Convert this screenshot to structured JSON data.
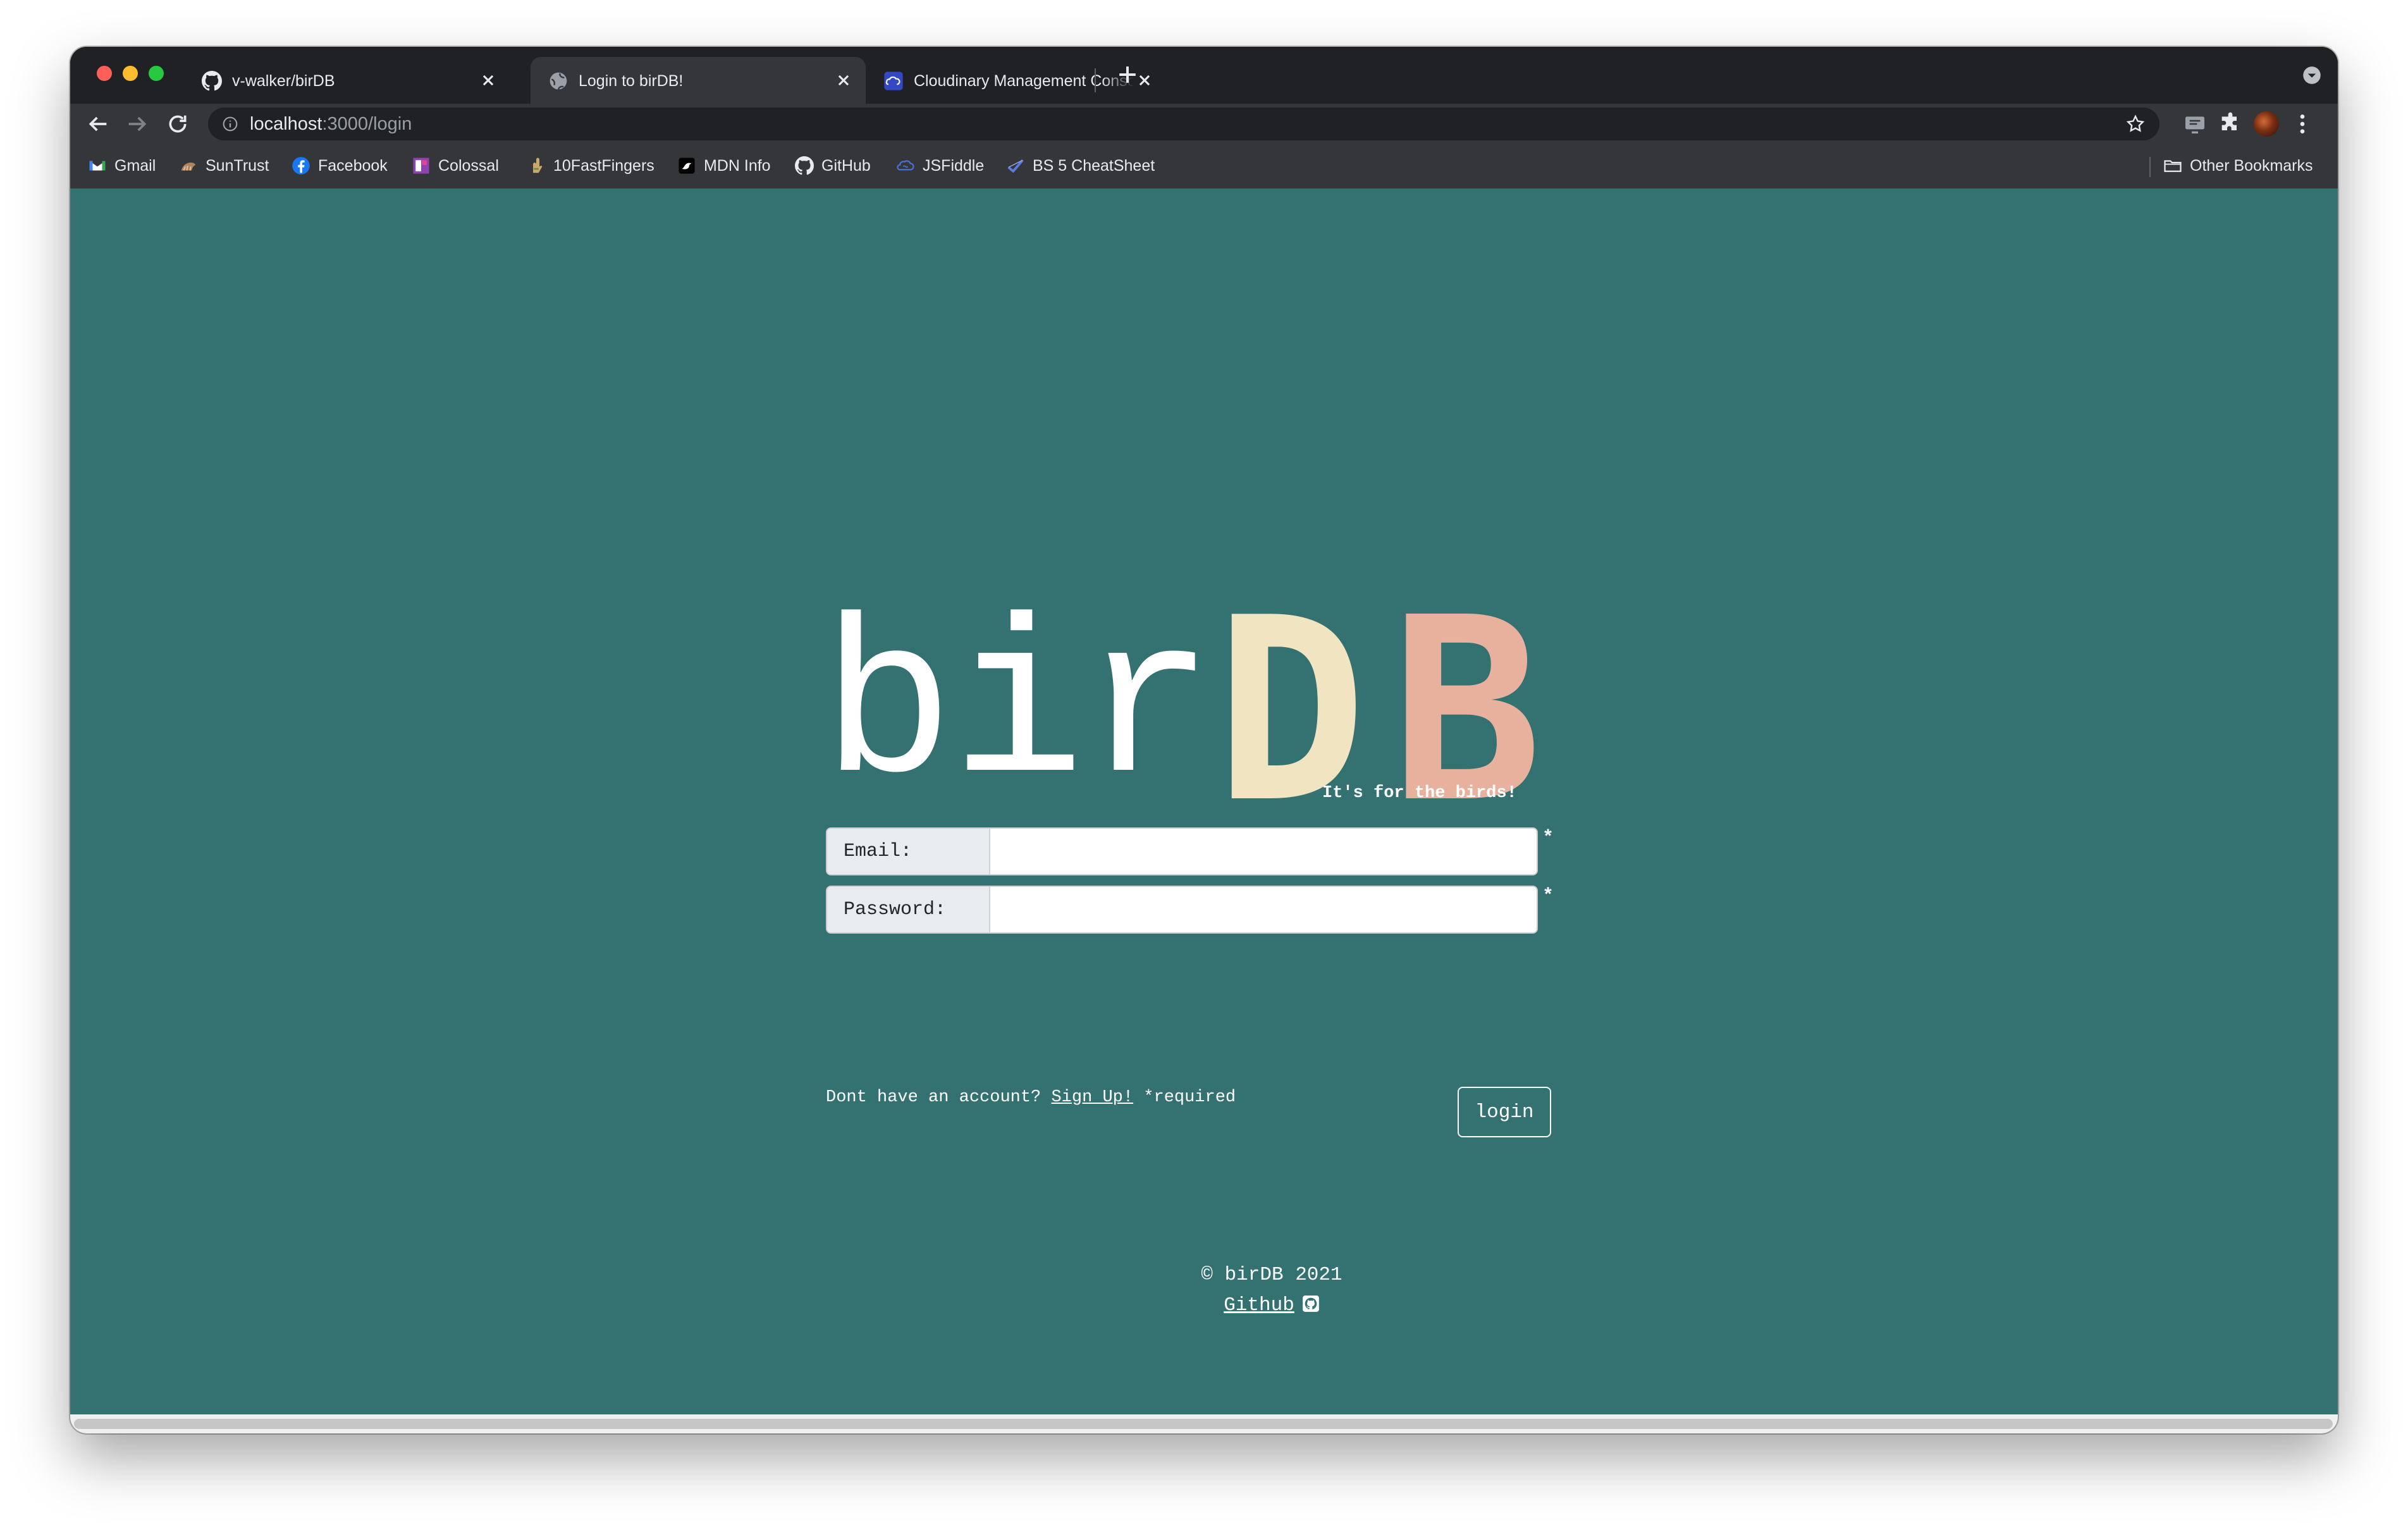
{
  "browser": {
    "tabs": [
      {
        "title": "v-walker/birDB",
        "icon": "github-icon",
        "active": false
      },
      {
        "title": "Login to birDB!",
        "icon": "globe-icon",
        "active": true
      },
      {
        "title": "Cloudinary Management Console",
        "icon": "cloudinary-icon",
        "active": false
      }
    ],
    "url_host": "localhost",
    "url_path": ":3000/login",
    "bookmarks": [
      {
        "label": "Gmail",
        "icon": "gmail-icon"
      },
      {
        "label": "SunTrust",
        "icon": "suntrust-icon"
      },
      {
        "label": "Facebook",
        "icon": "facebook-icon"
      },
      {
        "label": "Colossal",
        "icon": "colossal-icon"
      },
      {
        "label": "10FastFingers",
        "icon": "10fastfingers-icon"
      },
      {
        "label": "MDN Info",
        "icon": "mdn-icon"
      },
      {
        "label": "GitHub",
        "icon": "github-icon"
      },
      {
        "label": "JSFiddle",
        "icon": "jsfiddle-icon"
      },
      {
        "label": "BS 5 CheatSheet",
        "icon": "bootstrap-icon"
      }
    ],
    "other_bookmarks": "Other Bookmarks"
  },
  "page": {
    "logo": {
      "part1": "bir",
      "part2": "D",
      "part3": "B"
    },
    "tagline": "It's for the birds!",
    "email_label": "Email:",
    "password_label": "Password:",
    "required_marker": "*",
    "helper_prefix": "Dont have an account?",
    "signup_link": "Sign Up!",
    "required_note": "*required",
    "login_button": "login",
    "footer_copyright": "© birDB 2021",
    "footer_github": "Github"
  },
  "colors": {
    "page_background": "#347272",
    "logo_d": "#f1e4c0",
    "logo_b": "#e8b19e"
  }
}
